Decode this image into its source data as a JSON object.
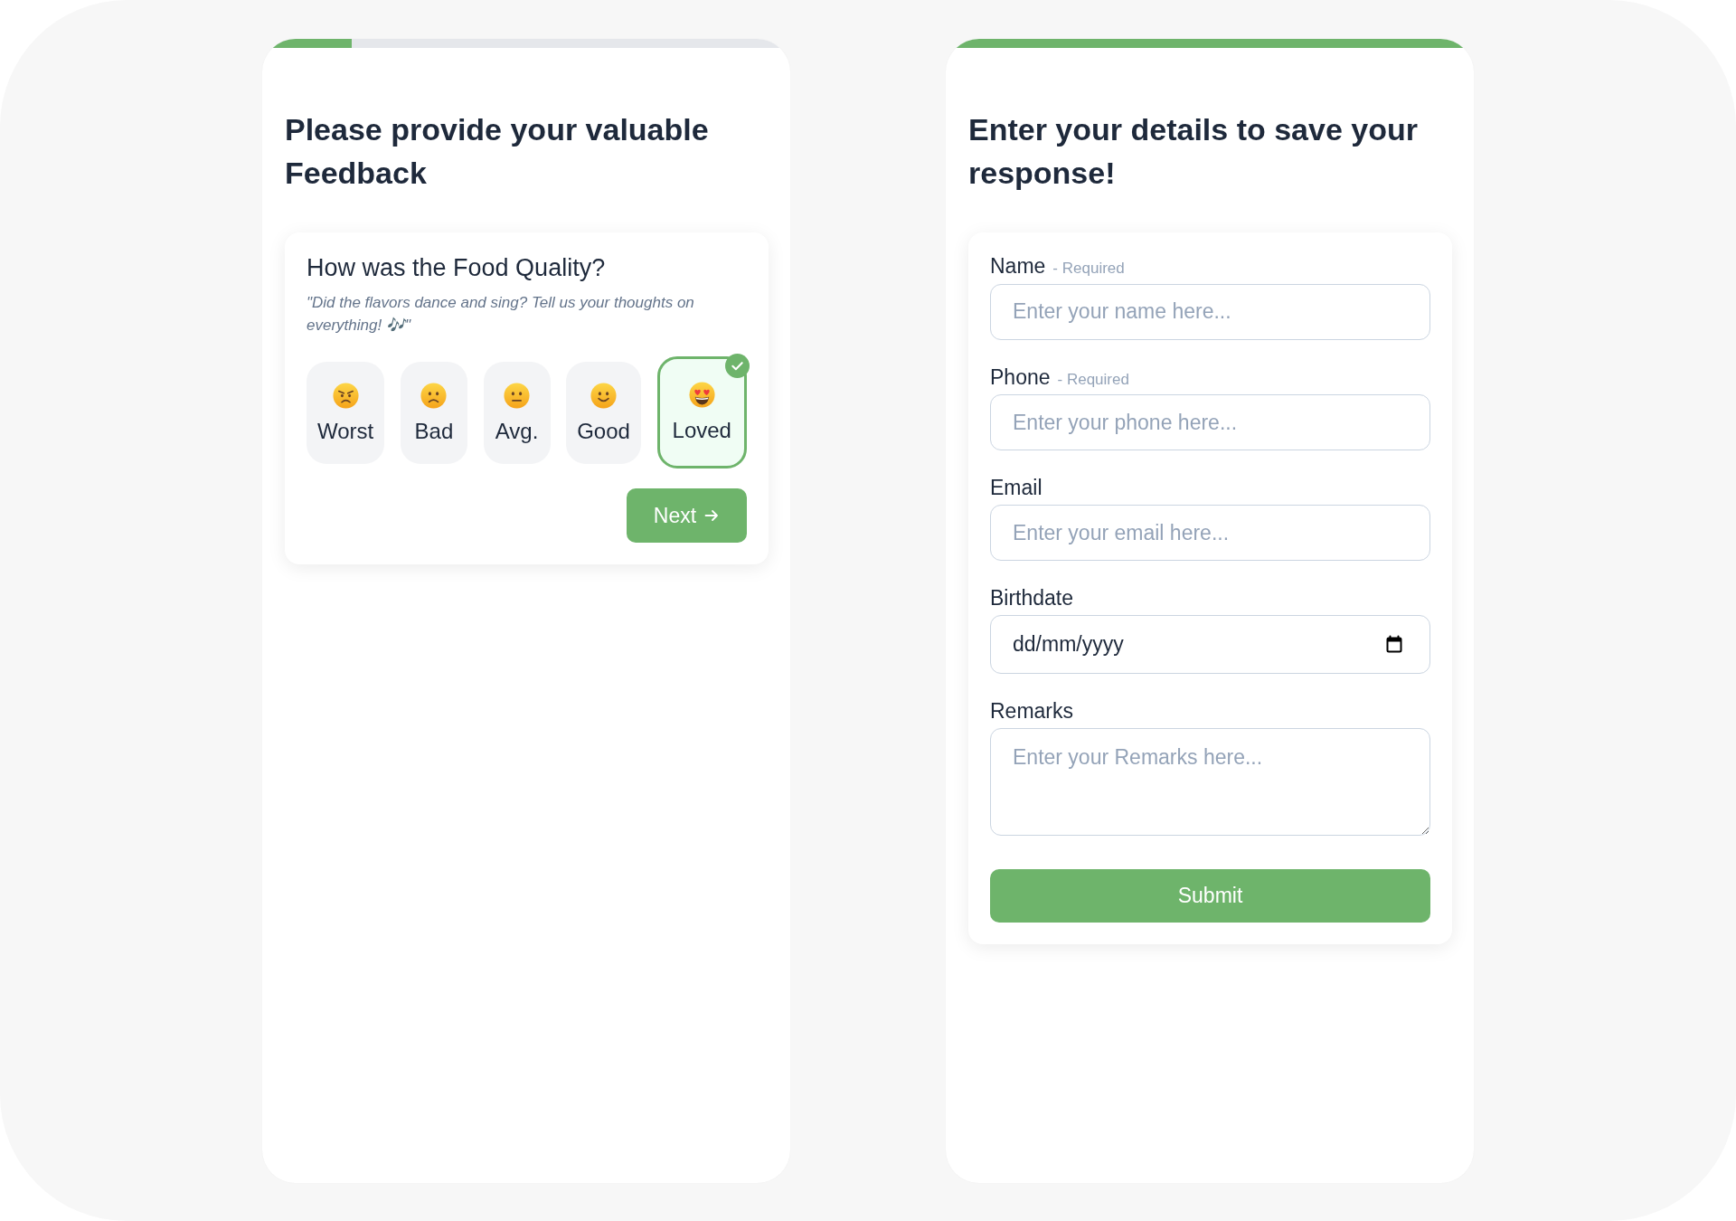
{
  "screens": [
    {
      "kind": "rating",
      "progress": {
        "level": 0.17
      },
      "title": "Please provide your valuable Feedback",
      "question": {
        "title": "How was the Food Quality?",
        "description": "\"Did the flavors dance and sing? Tell us your thoughts on everything! 🎶\"",
        "options": [
          {
            "label": "Worst",
            "kind": "angry",
            "selected": false
          },
          {
            "label": "Bad",
            "kind": "frowning",
            "selected": false
          },
          {
            "label": "Avg.",
            "kind": "neutral",
            "selected": false
          },
          {
            "label": "Good",
            "kind": "smiling",
            "selected": false
          },
          {
            "label": "Loved",
            "kind": "hearts",
            "selected": true
          }
        ],
        "next_button": "Next"
      }
    },
    {
      "kind": "details",
      "progress": {
        "level": 1
      },
      "title": "Enter your details to save your response!",
      "form": {
        "fields": [
          {
            "kind": "text",
            "label": "Name",
            "note": "- Required",
            "placeholder": "Enter your name here..."
          },
          {
            "kind": "text",
            "label": "Phone",
            "note": "- Required",
            "placeholder": "Enter your phone here..."
          },
          {
            "kind": "text",
            "label": "Email",
            "placeholder": "Enter your email here..."
          },
          {
            "kind": "date",
            "label": "Birthdate",
            "placeholder": "dd/mm/yyyy"
          },
          {
            "kind": "textarea",
            "label": "Remarks",
            "placeholder": "Enter your Remarks here..."
          }
        ],
        "submit_button": "Submit"
      }
    }
  ]
}
